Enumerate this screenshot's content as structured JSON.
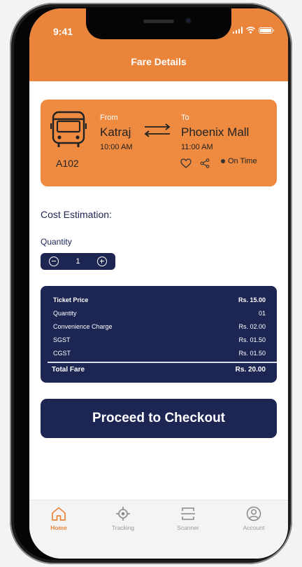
{
  "status_bar": {
    "time": "9:41"
  },
  "header": {
    "title": "Fare Details"
  },
  "trip": {
    "route_id": "A102",
    "from_label": "From",
    "from_stop": "Katraj",
    "from_time": "10:00 AM",
    "to_label": "To",
    "to_stop": "Phoenix Mall",
    "to_time": "11:00 AM",
    "status": "On Time"
  },
  "cost": {
    "section_title": "Cost Estimation:",
    "quantity_label": "Quantity",
    "quantity_value": "1"
  },
  "fare": {
    "rows": [
      {
        "label": "Ticket Price",
        "value": "Rs. 15.00"
      },
      {
        "label": "Quantity",
        "value": "01"
      },
      {
        "label": "Convenience Charge",
        "value": "Rs. 02.00"
      },
      {
        "label": "SGST",
        "value": "Rs. 01.50"
      },
      {
        "label": "CGST",
        "value": "Rs. 01.50"
      }
    ],
    "total_label": "Total Fare",
    "total_value": "Rs. 20.00"
  },
  "checkout": {
    "label": "Proceed to Checkout"
  },
  "tabs": [
    {
      "label": "Home",
      "icon": "home-icon"
    },
    {
      "label": "Tracking",
      "icon": "tracking-icon"
    },
    {
      "label": "Scanner",
      "icon": "scanner-icon"
    },
    {
      "label": "Account",
      "icon": "account-icon"
    }
  ],
  "colors": {
    "accent": "#e9843a",
    "card": "#ef8b41",
    "navy": "#1d2553"
  }
}
